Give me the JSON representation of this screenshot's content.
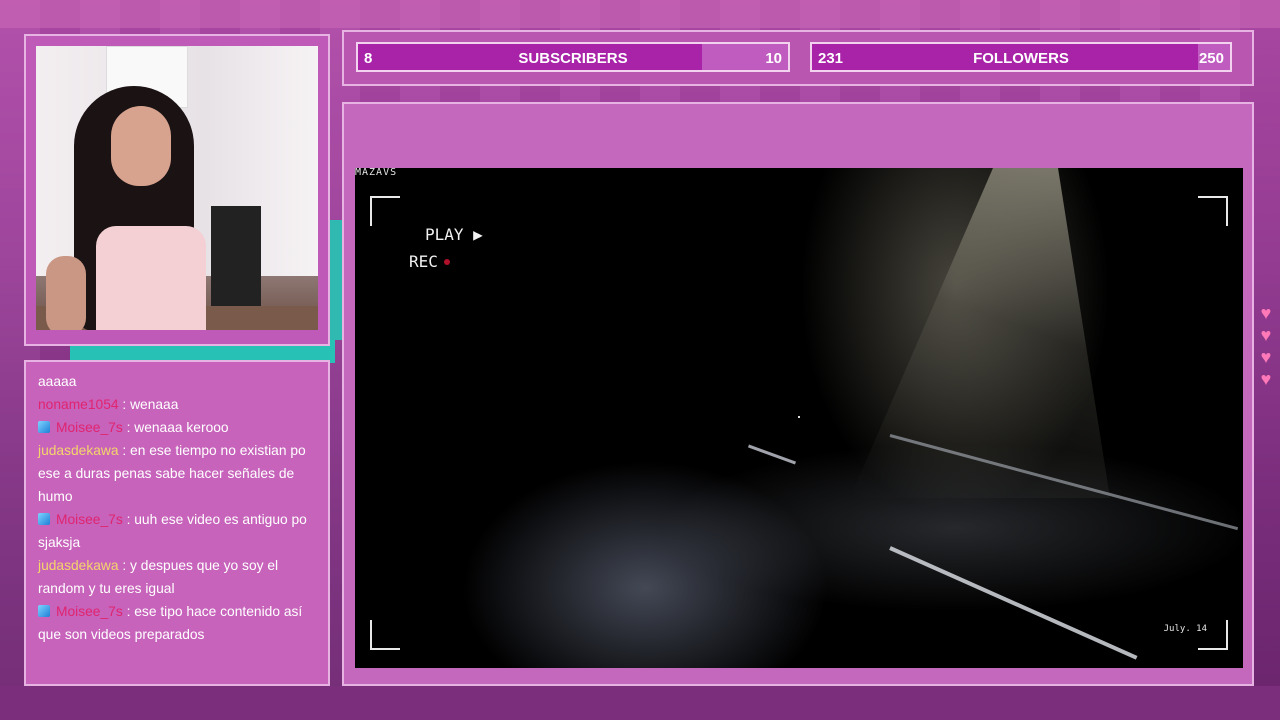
{
  "stats": {
    "subscribers": {
      "current": "8",
      "label": "SUBSCRIBERS",
      "goal": "10",
      "progress": 0.8
    },
    "followers": {
      "current": "231",
      "label": "FOLLOWERS",
      "goal": "250",
      "progress": 0.924
    }
  },
  "chat": {
    "messages": [
      {
        "user": "",
        "text": "aaaaa",
        "color": "",
        "badge": false
      },
      {
        "user": "noname1054",
        "text": ": wenaaa",
        "color": "red",
        "badge": false
      },
      {
        "user": "Moisee_7s",
        "text": ": wenaaa kerooo",
        "color": "red",
        "badge": true
      },
      {
        "user": "judasdekawa",
        "text": ": en ese tiempo no existian po ese a duras penas sabe hacer señales de humo",
        "color": "gold",
        "badge": false
      },
      {
        "user": "Moisee_7s",
        "text": ": uuh ese video es antiguo po sjaksja",
        "color": "red",
        "badge": true
      },
      {
        "user": "judasdekawa",
        "text": ": y despues que yo soy el random y tu eres igual",
        "color": "gold",
        "badge": false
      },
      {
        "user": "Moisee_7s",
        "text": ": ese tipo hace contenido así que son videos preparados",
        "color": "red",
        "badge": true
      }
    ]
  },
  "game": {
    "watermark": "MAZAVS",
    "play_label": "PLAY ▶",
    "rec_label": "REC",
    "date": "July. 14"
  },
  "colors": {
    "bar_fill": "#b52ab3",
    "chat_red": "#e0246f",
    "chat_gold": "#f4d56a"
  }
}
